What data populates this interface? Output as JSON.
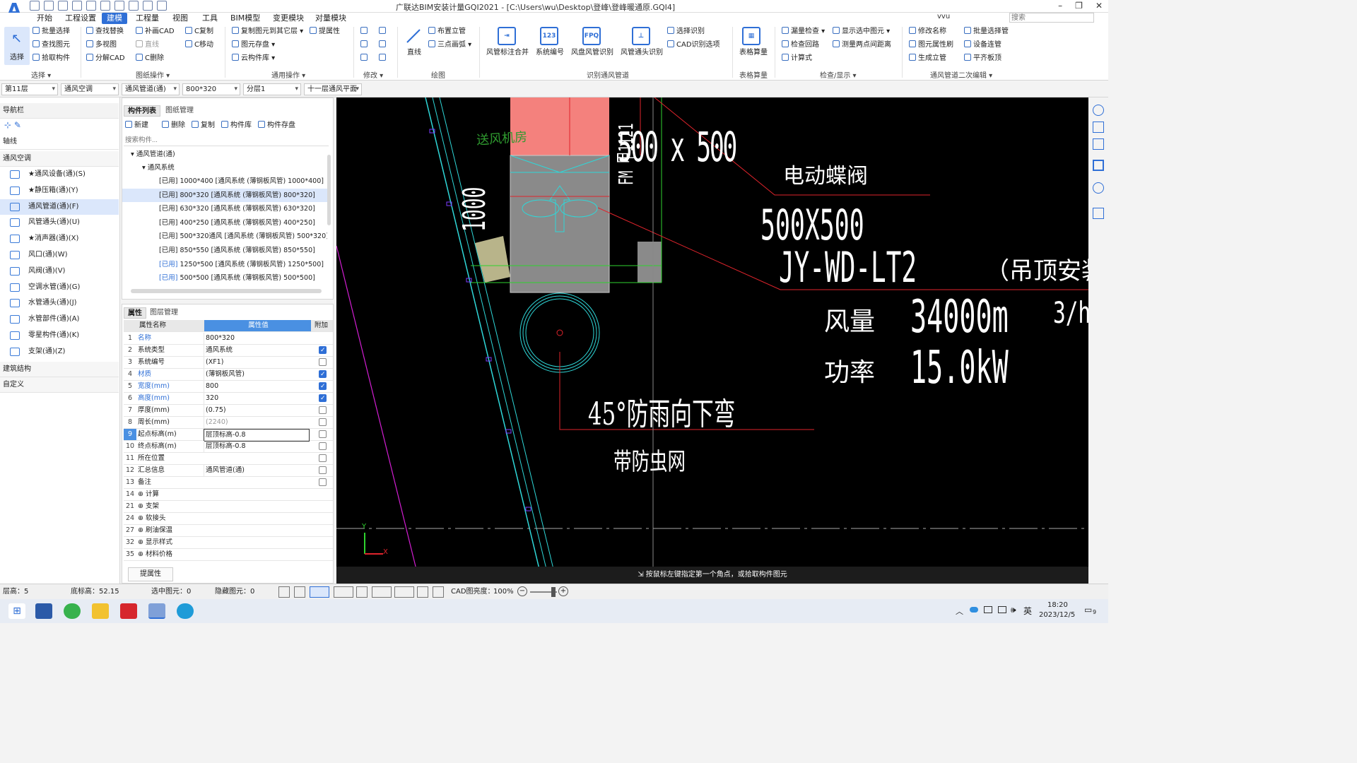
{
  "app": {
    "title": "广联达BIM安装计量GQI2021 - [C:\\Users\\wu\\Desktop\\登峰\\登峰暖通原.GQI4]",
    "user": "vvu",
    "search_placeholder": "搜索"
  },
  "menu": [
    "开始",
    "工程设置",
    "建模",
    "工程量",
    "视图",
    "工具",
    "BIM模型",
    "变更模块",
    "对量模块"
  ],
  "menu_active": "建模",
  "ribbon": {
    "select": {
      "label": "选择",
      "group": "选择 ▾"
    },
    "select_items": [
      "批量选择",
      "查找图元",
      "拾取构件"
    ],
    "drawing_ops_items": [
      "查找替换",
      "多视图",
      "分解CAD",
      "补画CAD",
      "直线",
      "C删除",
      "C复制",
      "C移动"
    ],
    "drawing_ops_group": "图纸操作 ▾",
    "common_items": [
      "复制图元到其它层",
      "图元存盘",
      "云构件库",
      "提属性"
    ],
    "common_group": "通用操作 ▾",
    "modify_group": "修改 ▾",
    "draw": {
      "line": "直线",
      "vertical_pipe": "布置立管",
      "three_arc": "三点画弧",
      "group": "绘图"
    },
    "recognize": {
      "items": [
        "风管标注合并",
        "系统编号",
        "风盘风管识别",
        "风管通头识别"
      ],
      "small": [
        "选择识别",
        "CAD识别选项"
      ],
      "group": "识别通风管道",
      "sys_icon": "123",
      "fpq_icon": "FPQ"
    },
    "table": {
      "label": "表格算量",
      "group": "表格算量"
    },
    "check": {
      "items": [
        "漏量检查",
        "检查回路",
        "计算式",
        "显示选中图元",
        "测量两点间距离"
      ],
      "group": "检查/显示 ▾"
    },
    "edit2": {
      "items": [
        "修改名称",
        "图元属性刷",
        "生成立管",
        "批量选择管",
        "设备连管",
        "平齐板顶"
      ],
      "group": "通风管道二次编辑 ▾"
    }
  },
  "toolbar2": {
    "floor": "第11层",
    "discipline": "通风空调",
    "type": "通风管道(通)",
    "size": "800*320",
    "layer": "分层1",
    "drawing": "十一层通风平面"
  },
  "nav": {
    "header": "导航栏",
    "axis": "轴线",
    "category": "通风空调",
    "items": [
      "★通风设备(通)(S)",
      "★静压箱(通)(Y)",
      "通风管道(通)(F)",
      "风管通头(通)(U)",
      "★消声器(通)(X)",
      "风口(通)(W)",
      "风阀(通)(V)",
      "空调水管(通)(G)",
      "水管通头(通)(J)",
      "水管部件(通)(A)",
      "零星构件(通)(K)",
      "支架(通)(Z)"
    ],
    "selected_index": 2,
    "bottom": [
      "建筑结构",
      "自定义"
    ]
  },
  "components": {
    "tabs": [
      "构件列表",
      "图纸管理"
    ],
    "actions": [
      "新建",
      "删除",
      "复制",
      "构件库",
      "构件存盘"
    ],
    "search_placeholder": "搜索构件...",
    "tree_root": "通风管道(通)",
    "tree_sub": "通风系统",
    "rows": [
      {
        "tag": "[已用]",
        "text": " 1000*400 [通风系统 (薄钢板风管) 1000*400]"
      },
      {
        "tag": "[已用]",
        "text": " 800*320 [通风系统 (薄钢板风管) 800*320]"
      },
      {
        "tag": "[已用]",
        "text": " 630*320 [通风系统 (薄钢板风管) 630*320]"
      },
      {
        "tag": "[已用]",
        "text": " 400*250 [通风系统 (薄钢板风管) 400*250]"
      },
      {
        "tag": "[已用]",
        "text": " 500*320通风 [通风系统 (薄钢板风管) 500*320]"
      },
      {
        "tag": "[已用]",
        "text": " 850*550 [通风系统 (薄钢板风管) 850*550]"
      },
      {
        "tag": "[已用]",
        "text": " 1250*500 [通风系统 (薄钢板风管) 1250*500]"
      },
      {
        "tag": "[已用]",
        "text": " 500*500 [通风系统 (薄钢板风管) 500*500]"
      }
    ],
    "selected_index": 1
  },
  "properties": {
    "tabs": [
      "属性",
      "图层管理"
    ],
    "headers": [
      "属性名称",
      "属性值",
      "附加"
    ],
    "rows": [
      {
        "n": "1",
        "k": "名称",
        "v": "800*320",
        "blue": true,
        "c": "none"
      },
      {
        "n": "2",
        "k": "系统类型",
        "v": "通风系统",
        "blue": false,
        "c": "on"
      },
      {
        "n": "3",
        "k": "系统编号",
        "v": "(XF1)",
        "blue": false,
        "c": "off"
      },
      {
        "n": "4",
        "k": "材质",
        "v": "(薄钢板风管)",
        "blue": true,
        "c": "on"
      },
      {
        "n": "5",
        "k": "宽度(mm)",
        "v": "800",
        "blue": true,
        "c": "on"
      },
      {
        "n": "6",
        "k": "高度(mm)",
        "v": "320",
        "blue": true,
        "c": "on"
      },
      {
        "n": "7",
        "k": "厚度(mm)",
        "v": "(0.75)",
        "blue": false,
        "c": "off"
      },
      {
        "n": "8",
        "k": "周长(mm)",
        "v": "(2240)",
        "blue": false,
        "c": "off"
      },
      {
        "n": "9",
        "k": "起点标高(m)",
        "v": "层顶标高-0.8",
        "blue": false,
        "c": "off"
      },
      {
        "n": "10",
        "k": "终点标高(m)",
        "v": "层顶标高-0.8",
        "blue": false,
        "c": "off"
      },
      {
        "n": "11",
        "k": "所在位置",
        "v": "",
        "blue": false,
        "c": "off"
      },
      {
        "n": "12",
        "k": "汇总信息",
        "v": "通风管道(通)",
        "blue": false,
        "c": "off"
      },
      {
        "n": "13",
        "k": "备注",
        "v": "",
        "blue": false,
        "c": "off"
      },
      {
        "n": "14",
        "k": "⊕ 计算",
        "v": "",
        "blue": false,
        "c": "none"
      },
      {
        "n": "21",
        "k": "⊕ 支架",
        "v": "",
        "blue": false,
        "c": "none"
      },
      {
        "n": "24",
        "k": "⊕ 软接头",
        "v": "",
        "blue": false,
        "c": "none"
      },
      {
        "n": "27",
        "k": "⊕ 刷油保温",
        "v": "",
        "blue": false,
        "c": "none"
      },
      {
        "n": "32",
        "k": "⊕ 显示样式",
        "v": "",
        "blue": false,
        "c": "none"
      },
      {
        "n": "35",
        "k": "⊕ 材料价格",
        "v": "",
        "blue": false,
        "c": "none"
      }
    ],
    "button": "提属性"
  },
  "cad": {
    "label_room": "送风机房",
    "size_top": "500 x 500",
    "damper": "电动蝶阀",
    "size2": "500X500",
    "model": "JY-WD-LT2",
    "install": "（吊顶安装）",
    "airflow_label": "风量",
    "airflow_value": "34000m",
    "airflow_unit": "3/h",
    "power_label": "功率",
    "power_value": "15.0kW",
    "elbow": "45°防雨向下弯",
    "net": "带防虫网",
    "dim_vertical": "1000",
    "fm_label": "FM 甲1121",
    "prompt": "按鼠标左键指定第一个角点，或拾取构件图元",
    "axis_x": "X",
    "axis_y": "Y"
  },
  "status": {
    "floor_height": "层高：5",
    "bottom_elev": "底标高：52.15",
    "selected": "选中图元：0",
    "hidden": "隐藏图元：0",
    "cad_brightness_label": "CAD图亮度：",
    "cad_brightness": "100%"
  },
  "taskbar": {
    "time": "18:20",
    "date": "2023/12/5",
    "ime": "英",
    "notif": "9"
  },
  "colors": {
    "accent": "#2f6fd6",
    "canvas": "#000000",
    "duct_fill": "#8a8a8a",
    "pink_box": "#f4817d",
    "cad_red": "#e0242c",
    "cad_cyan": "#2fd7d8",
    "cad_green": "#2fd22f",
    "cad_magenta": "#d21ed2"
  }
}
